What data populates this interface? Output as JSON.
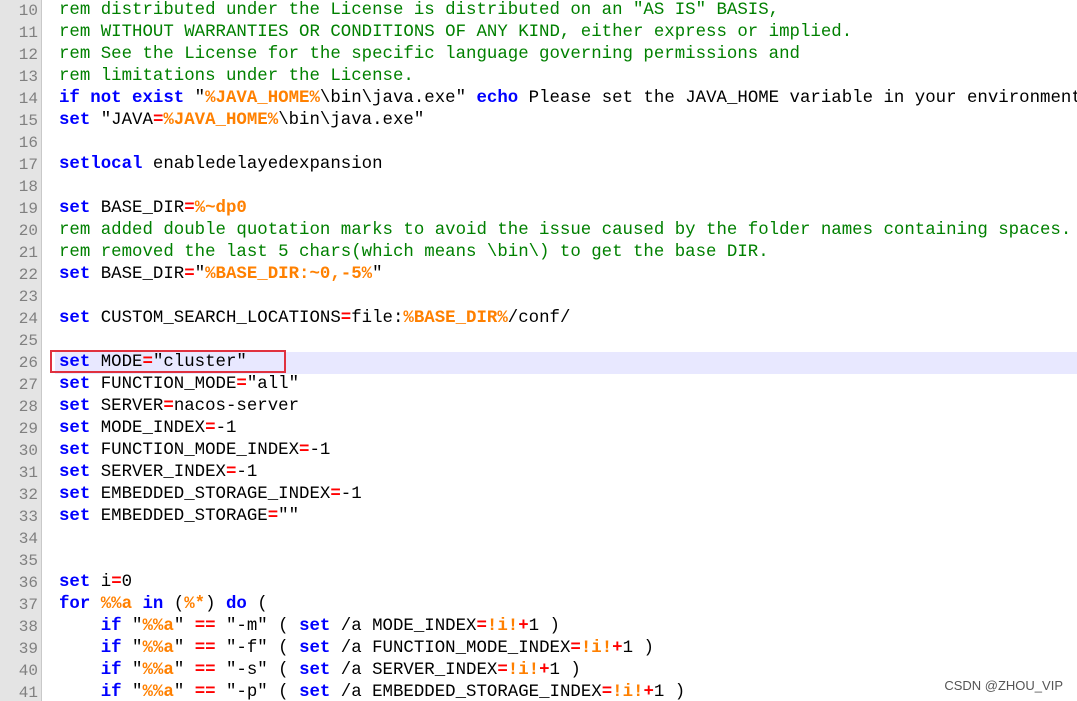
{
  "watermark": "CSDN @ZHOU_VIP",
  "lines": [
    {
      "n": "10",
      "t": [
        [
          "cmt",
          "rem distributed under the License is distributed on an \"AS IS\" BASIS,"
        ]
      ]
    },
    {
      "n": "11",
      "t": [
        [
          "cmt",
          "rem WITHOUT WARRANTIES OR CONDITIONS OF ANY KIND, either express or implied."
        ]
      ]
    },
    {
      "n": "12",
      "t": [
        [
          "cmt",
          "rem See the License for the specific language governing permissions and"
        ]
      ]
    },
    {
      "n": "13",
      "t": [
        [
          "cmt",
          "rem limitations under the License."
        ]
      ]
    },
    {
      "n": "14",
      "t": [
        [
          "kw",
          "if not exist "
        ],
        [
          "str",
          "\""
        ],
        [
          "var",
          "%JAVA_HOME%"
        ],
        [
          "str",
          "\\bin\\java.exe\" "
        ],
        [
          "kw",
          "echo"
        ],
        [
          "text",
          " Please set the JAVA_HOME variable in your environment"
        ]
      ]
    },
    {
      "n": "15",
      "t": [
        [
          "kw",
          "set"
        ],
        [
          "text",
          " \"JAVA"
        ],
        [
          "op",
          "="
        ],
        [
          "var",
          "%JAVA_HOME%"
        ],
        [
          "text",
          "\\bin\\java.exe\""
        ]
      ]
    },
    {
      "n": "16",
      "t": []
    },
    {
      "n": "17",
      "t": [
        [
          "kw",
          "setlocal"
        ],
        [
          "text",
          " enabledelayedexpansion"
        ]
      ]
    },
    {
      "n": "18",
      "t": []
    },
    {
      "n": "19",
      "t": [
        [
          "kw",
          "set"
        ],
        [
          "text",
          " BASE_DIR"
        ],
        [
          "op",
          "="
        ],
        [
          "var",
          "%~dp0"
        ]
      ]
    },
    {
      "n": "20",
      "t": [
        [
          "cmt",
          "rem added double quotation marks to avoid the issue caused by the folder names containing spaces."
        ]
      ]
    },
    {
      "n": "21",
      "t": [
        [
          "cmt",
          "rem removed the last 5 chars(which means \\bin\\) to get the base DIR."
        ]
      ]
    },
    {
      "n": "22",
      "t": [
        [
          "kw",
          "set"
        ],
        [
          "text",
          " BASE_DIR"
        ],
        [
          "op",
          "="
        ],
        [
          "text",
          "\""
        ],
        [
          "var",
          "%BASE_DIR:~0,-5%"
        ],
        [
          "text",
          "\""
        ]
      ]
    },
    {
      "n": "23",
      "t": []
    },
    {
      "n": "24",
      "t": [
        [
          "kw",
          "set"
        ],
        [
          "text",
          " CUSTOM_SEARCH_LOCATIONS"
        ],
        [
          "op",
          "="
        ],
        [
          "text",
          "file:"
        ],
        [
          "var",
          "%BASE_DIR%"
        ],
        [
          "text",
          "/conf/"
        ]
      ]
    },
    {
      "n": "25",
      "t": []
    },
    {
      "n": "26",
      "current": true,
      "t": [
        [
          "kw",
          "set"
        ],
        [
          "text",
          " MODE"
        ],
        [
          "op",
          "="
        ],
        [
          "text",
          "\"cluster\""
        ]
      ]
    },
    {
      "n": "27",
      "t": [
        [
          "kw",
          "set"
        ],
        [
          "text",
          " FUNCTION_MODE"
        ],
        [
          "op",
          "="
        ],
        [
          "text",
          "\"all\""
        ]
      ]
    },
    {
      "n": "28",
      "t": [
        [
          "kw",
          "set"
        ],
        [
          "text",
          " SERVER"
        ],
        [
          "op",
          "="
        ],
        [
          "text",
          "nacos-server"
        ]
      ]
    },
    {
      "n": "29",
      "t": [
        [
          "kw",
          "set"
        ],
        [
          "text",
          " MODE_INDEX"
        ],
        [
          "op",
          "="
        ],
        [
          "text",
          "-1"
        ]
      ]
    },
    {
      "n": "30",
      "t": [
        [
          "kw",
          "set"
        ],
        [
          "text",
          " FUNCTION_MODE_INDEX"
        ],
        [
          "op",
          "="
        ],
        [
          "text",
          "-1"
        ]
      ]
    },
    {
      "n": "31",
      "t": [
        [
          "kw",
          "set"
        ],
        [
          "text",
          " SERVER_INDEX"
        ],
        [
          "op",
          "="
        ],
        [
          "text",
          "-1"
        ]
      ]
    },
    {
      "n": "32",
      "t": [
        [
          "kw",
          "set"
        ],
        [
          "text",
          " EMBEDDED_STORAGE_INDEX"
        ],
        [
          "op",
          "="
        ],
        [
          "text",
          "-1"
        ]
      ]
    },
    {
      "n": "33",
      "t": [
        [
          "kw",
          "set"
        ],
        [
          "text",
          " EMBEDDED_STORAGE"
        ],
        [
          "op",
          "="
        ],
        [
          "text",
          "\"\""
        ]
      ]
    },
    {
      "n": "34",
      "t": []
    },
    {
      "n": "35",
      "t": []
    },
    {
      "n": "36",
      "t": [
        [
          "kw",
          "set"
        ],
        [
          "text",
          " i"
        ],
        [
          "op",
          "="
        ],
        [
          "text",
          "0"
        ]
      ]
    },
    {
      "n": "37",
      "t": [
        [
          "kw",
          "for"
        ],
        [
          "text",
          " "
        ],
        [
          "var",
          "%%a"
        ],
        [
          "text",
          " "
        ],
        [
          "kw",
          "in"
        ],
        [
          "text",
          " ("
        ],
        [
          "var",
          "%*"
        ],
        [
          "text",
          ") "
        ],
        [
          "kw",
          "do"
        ],
        [
          "text",
          " ("
        ]
      ]
    },
    {
      "n": "38",
      "t": [
        [
          "text",
          "    "
        ],
        [
          "kw",
          "if"
        ],
        [
          "text",
          " \""
        ],
        [
          "var",
          "%%a"
        ],
        [
          "text",
          "\" "
        ],
        [
          "op",
          "=="
        ],
        [
          "text",
          " \"-m\" ( "
        ],
        [
          "kw",
          "set"
        ],
        [
          "text",
          " /a MODE_INDEX"
        ],
        [
          "op",
          "="
        ],
        [
          "var",
          "!i!"
        ],
        [
          "op",
          "+"
        ],
        [
          "text",
          "1 )"
        ]
      ]
    },
    {
      "n": "39",
      "t": [
        [
          "text",
          "    "
        ],
        [
          "kw",
          "if"
        ],
        [
          "text",
          " \""
        ],
        [
          "var",
          "%%a"
        ],
        [
          "text",
          "\" "
        ],
        [
          "op",
          "=="
        ],
        [
          "text",
          " \"-f\" ( "
        ],
        [
          "kw",
          "set"
        ],
        [
          "text",
          " /a FUNCTION_MODE_INDEX"
        ],
        [
          "op",
          "="
        ],
        [
          "var",
          "!i!"
        ],
        [
          "op",
          "+"
        ],
        [
          "text",
          "1 )"
        ]
      ]
    },
    {
      "n": "40",
      "t": [
        [
          "text",
          "    "
        ],
        [
          "kw",
          "if"
        ],
        [
          "text",
          " \""
        ],
        [
          "var",
          "%%a"
        ],
        [
          "text",
          "\" "
        ],
        [
          "op",
          "=="
        ],
        [
          "text",
          " \"-s\" ( "
        ],
        [
          "kw",
          "set"
        ],
        [
          "text",
          " /a SERVER_INDEX"
        ],
        [
          "op",
          "="
        ],
        [
          "var",
          "!i!"
        ],
        [
          "op",
          "+"
        ],
        [
          "text",
          "1 )"
        ]
      ]
    },
    {
      "n": "41",
      "t": [
        [
          "text",
          "    "
        ],
        [
          "kw",
          "if"
        ],
        [
          "text",
          " \""
        ],
        [
          "var",
          "%%a"
        ],
        [
          "text",
          "\" "
        ],
        [
          "op",
          "=="
        ],
        [
          "text",
          " \"-p\" ( "
        ],
        [
          "kw",
          "set"
        ],
        [
          "text",
          " /a EMBEDDED_STORAGE_INDEX"
        ],
        [
          "op",
          "="
        ],
        [
          "var",
          "!i!"
        ],
        [
          "op",
          "+"
        ],
        [
          "text",
          "1 )"
        ]
      ]
    }
  ]
}
